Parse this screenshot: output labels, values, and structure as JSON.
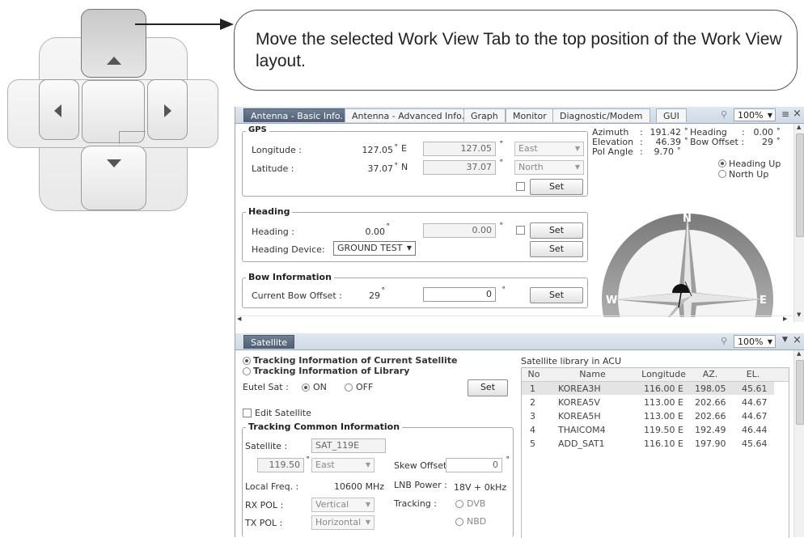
{
  "callout": {
    "text": "Move the selected Work View Tab to the top position of the Work View layout."
  },
  "top_panel": {
    "tabs": [
      {
        "label": "Antenna - Basic Info.",
        "active": true
      },
      {
        "label": "Antenna - Advanced Info.",
        "active": false
      },
      {
        "label": "Graph",
        "active": false
      },
      {
        "label": "Monitor",
        "active": false
      },
      {
        "label": "Diagnostic/Modem",
        "active": false
      },
      {
        "label": "GUI",
        "active": false
      }
    ],
    "zoom": "100%",
    "gps": {
      "title": "GPS",
      "longitude_label": "Longitude :",
      "longitude_value": "127.05",
      "longitude_unit": "˚ E",
      "longitude_input": "127.05",
      "longitude_dir": "East",
      "latitude_label": "Latitude :",
      "latitude_value": "37.07",
      "latitude_unit": "˚ N",
      "latitude_input": "37.07",
      "latitude_dir": "North",
      "degree": "˚",
      "set_label": "Set"
    },
    "heading": {
      "title": "Heading",
      "heading_label": "Heading :",
      "heading_value": "0.00",
      "heading_input": "0.00",
      "device_label": "Heading Device:",
      "device_value": "GROUND TEST",
      "set_label": "Set",
      "set2_label": "Set",
      "degree": "˚"
    },
    "bow": {
      "title": "Bow Information",
      "offset_label": "Current Bow Offset :",
      "offset_value": "29",
      "offset_input": "0",
      "set_label": "Set",
      "degree": "˚"
    },
    "status": {
      "azimuth_label": "Azimuth",
      "azimuth_value": "191.42 ˚",
      "elevation_label": "Elevation",
      "elevation_value": "46.39 ˚",
      "pol_label": "Pol Angle",
      "pol_value": "9.70 ˚",
      "sep": ":",
      "heading_label": "Heading",
      "heading_value": "0.00 ˚",
      "bow_label": "Bow Offset :",
      "bow_value": "29 ˚",
      "heading_up": "Heading Up",
      "north_up": "North Up"
    },
    "compass": {
      "n": "N",
      "w": "W",
      "e": "E"
    }
  },
  "bottom_panel": {
    "tab": "Satellite",
    "zoom": "100%",
    "track_current": "Tracking Information of Current Satellite",
    "track_library": "Tracking Information of Library",
    "eutel_label": "Eutel Sat :",
    "on_label": "ON",
    "off_label": "OFF",
    "set_label": "Set",
    "edit_satellite": "Edit Satellite",
    "common": {
      "title": "Tracking Common  Information",
      "satellite_label": "Satellite :",
      "satellite_value": "SAT_119E",
      "longitude_value": "119.50",
      "degree": "˚",
      "direction": "East",
      "skew_label": "Skew Offset :",
      "skew_value": "0",
      "freq_label": "Local Freq. :",
      "freq_value": "10600 MHz",
      "lnb_label": "LNB Power :",
      "lnb_value": "18V + 0kHz",
      "rx_label": "RX POL :",
      "rx_value": "Vertical",
      "tx_label": "TX POL :",
      "tx_value": "Horizontal",
      "tracking_label": "Tracking :",
      "dvb": "DVB",
      "nbd": "NBD"
    },
    "library": {
      "title": "Satellite library in ACU",
      "headers": [
        "No",
        "Name",
        "Longitude",
        "AZ.",
        "EL."
      ],
      "rows": [
        [
          "1",
          "KOREA3H",
          "116.00  E",
          "198.05",
          "45.61"
        ],
        [
          "2",
          "KOREA5V",
          "113.00  E",
          "202.66",
          "44.67"
        ],
        [
          "3",
          "KOREA5H",
          "113.00  E",
          "202.66",
          "44.67"
        ],
        [
          "4",
          "THAICOM4",
          "119.50  E",
          "192.49",
          "46.44"
        ],
        [
          "5",
          "ADD_SAT1",
          "116.10  E",
          "197.90",
          "45.64"
        ]
      ]
    }
  },
  "colors": {
    "active_tab": "#56657a",
    "selected_row": "#e4e4e4",
    "compass_dark": "#4a4a4a",
    "compass_light": "#eeeeee"
  }
}
